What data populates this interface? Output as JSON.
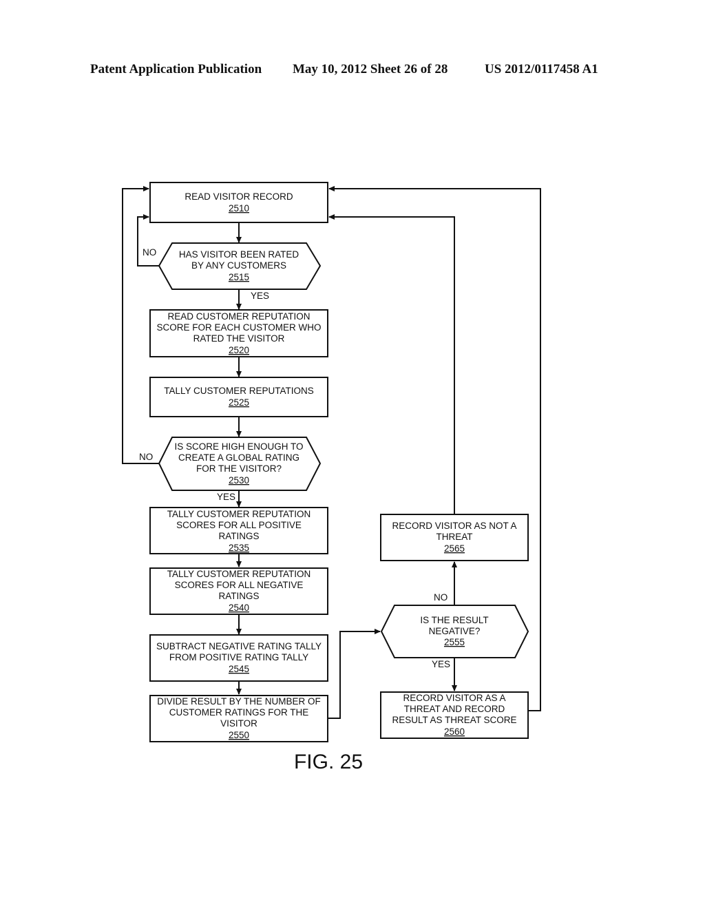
{
  "header": {
    "publication": "Patent Application Publication",
    "date_sheet": "May 10, 2012  Sheet 26 of 28",
    "number": "US 2012/0117458 A1"
  },
  "figure_label": "FIG. 25",
  "nodes": {
    "n2510": {
      "lines": [
        "READ VISITOR RECORD"
      ],
      "ref": "2510"
    },
    "n2515": {
      "lines": [
        "HAS VISITOR BEEN RATED",
        "BY ANY CUSTOMERS"
      ],
      "ref": "2515"
    },
    "n2520": {
      "lines": [
        "READ CUSTOMER REPUTATION",
        "SCORE FOR EACH CUSTOMER WHO",
        "RATED THE VISITOR"
      ],
      "ref": "2520"
    },
    "n2525": {
      "lines": [
        "TALLY CUSTOMER REPUTATIONS"
      ],
      "ref": "2525"
    },
    "n2530": {
      "lines": [
        "IS SCORE HIGH ENOUGH TO",
        "CREATE A GLOBAL RATING",
        "FOR THE VISITOR?"
      ],
      "ref": "2530"
    },
    "n2535": {
      "lines": [
        "TALLY CUSTOMER REPUTATION",
        "SCORES FOR ALL POSITIVE",
        "RATINGS"
      ],
      "ref": "2535"
    },
    "n2540": {
      "lines": [
        "TALLY CUSTOMER REPUTATION",
        "SCORES FOR ALL NEGATIVE",
        "RATINGS"
      ],
      "ref": "2540"
    },
    "n2545": {
      "lines": [
        "SUBTRACT NEGATIVE RATING TALLY",
        "FROM POSITIVE RATING TALLY"
      ],
      "ref": "2545"
    },
    "n2550": {
      "lines": [
        "DIVIDE RESULT BY THE NUMBER OF",
        "CUSTOMER RATINGS FOR THE",
        "VISITOR"
      ],
      "ref": "2550"
    },
    "n2555": {
      "lines": [
        "IS THE RESULT",
        "NEGATIVE?"
      ],
      "ref": "2555"
    },
    "n2560": {
      "lines": [
        "RECORD VISITOR AS A",
        "THREAT AND RECORD",
        "RESULT AS THREAT SCORE"
      ],
      "ref": "2560"
    },
    "n2565": {
      "lines": [
        "RECORD VISITOR AS NOT A",
        "THREAT"
      ],
      "ref": "2565"
    }
  },
  "edge_labels": {
    "e2515_no": "NO",
    "e2515_yes": "YES",
    "e2530_no": "NO",
    "e2530_yes": "YES",
    "e2555_no": "NO",
    "e2555_yes": "YES"
  }
}
